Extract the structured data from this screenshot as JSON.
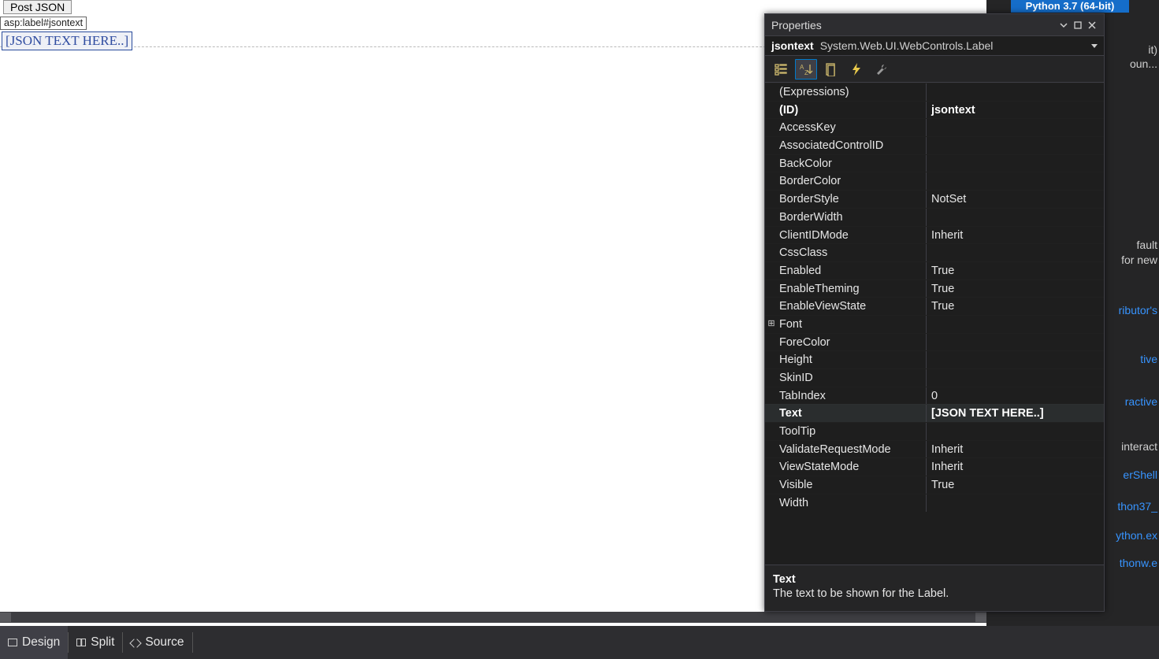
{
  "python_badge": "Python 3.7 (64-bit)",
  "design": {
    "button_label": "Post JSON",
    "tag_chip": "asp:label#jsontext",
    "json_label_text": "[JSON TEXT HERE..]"
  },
  "background_text": {
    "t1": "it)",
    "t2": "oun...",
    "t3": "fault",
    "t4": "for new",
    "t5": "ributor's",
    "t6": "tive",
    "t7": "ractive",
    "t8": "interact",
    "t9": "erShell",
    "t10": "thon37_",
    "t11": "ython.ex",
    "t12": "thonw.e"
  },
  "bottom_tabs": {
    "design": "Design",
    "split": "Split",
    "source": "Source"
  },
  "properties_panel": {
    "title": "Properties",
    "object_name": "jsontext",
    "object_type": "System.Web.UI.WebControls.Label",
    "rows": [
      {
        "name": "(Expressions)",
        "value": "",
        "bold": false,
        "expander": ""
      },
      {
        "name": "(ID)",
        "value": "jsontext",
        "bold": true,
        "expander": ""
      },
      {
        "name": "AccessKey",
        "value": "",
        "bold": false,
        "expander": ""
      },
      {
        "name": "AssociatedControlID",
        "value": "",
        "bold": false,
        "expander": ""
      },
      {
        "name": "BackColor",
        "value": "",
        "bold": false,
        "expander": ""
      },
      {
        "name": "BorderColor",
        "value": "",
        "bold": false,
        "expander": ""
      },
      {
        "name": "BorderStyle",
        "value": "NotSet",
        "bold": false,
        "expander": ""
      },
      {
        "name": "BorderWidth",
        "value": "",
        "bold": false,
        "expander": ""
      },
      {
        "name": "ClientIDMode",
        "value": "Inherit",
        "bold": false,
        "expander": ""
      },
      {
        "name": "CssClass",
        "value": "",
        "bold": false,
        "expander": ""
      },
      {
        "name": "Enabled",
        "value": "True",
        "bold": false,
        "expander": ""
      },
      {
        "name": "EnableTheming",
        "value": "True",
        "bold": false,
        "expander": ""
      },
      {
        "name": "EnableViewState",
        "value": "True",
        "bold": false,
        "expander": ""
      },
      {
        "name": "Font",
        "value": "",
        "bold": false,
        "expander": "⊞"
      },
      {
        "name": "ForeColor",
        "value": "",
        "bold": false,
        "expander": ""
      },
      {
        "name": "Height",
        "value": "",
        "bold": false,
        "expander": ""
      },
      {
        "name": "SkinID",
        "value": "",
        "bold": false,
        "expander": ""
      },
      {
        "name": "TabIndex",
        "value": "0",
        "bold": false,
        "expander": ""
      },
      {
        "name": "Text",
        "value": "[JSON TEXT HERE..]",
        "bold": true,
        "expander": "",
        "selected": true
      },
      {
        "name": "ToolTip",
        "value": "",
        "bold": false,
        "expander": ""
      },
      {
        "name": "ValidateRequestMode",
        "value": "Inherit",
        "bold": false,
        "expander": ""
      },
      {
        "name": "ViewStateMode",
        "value": "Inherit",
        "bold": false,
        "expander": ""
      },
      {
        "name": "Visible",
        "value": "True",
        "bold": false,
        "expander": ""
      },
      {
        "name": "Width",
        "value": "",
        "bold": false,
        "expander": ""
      }
    ],
    "help_name": "Text",
    "help_desc": "The text to be shown for the Label."
  }
}
